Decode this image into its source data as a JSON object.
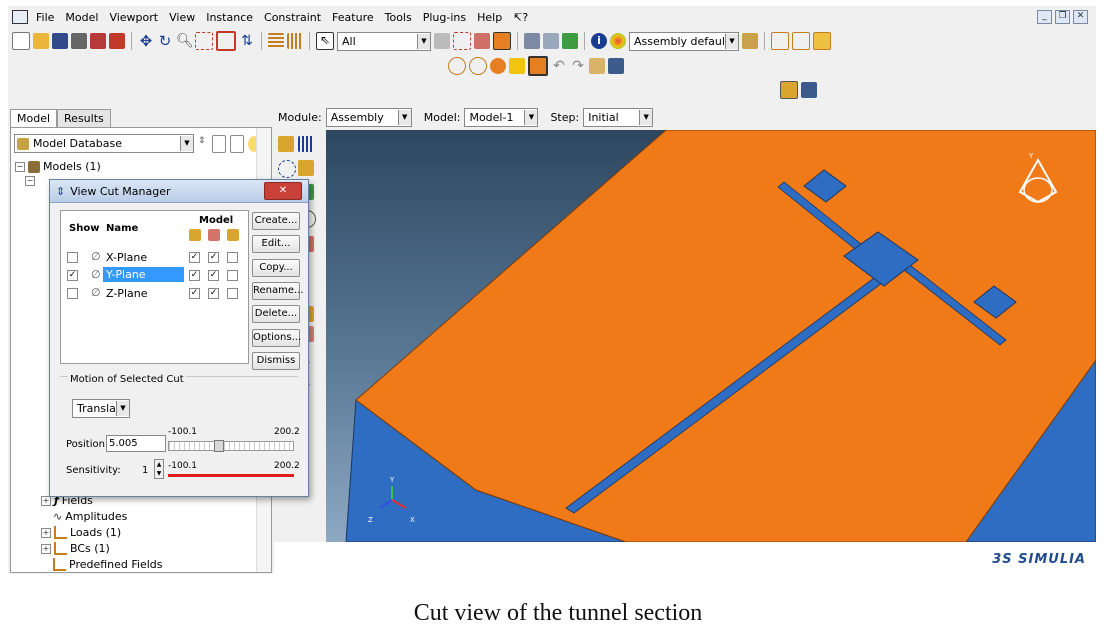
{
  "menu": [
    "File",
    "Model",
    "Viewport",
    "View",
    "Instance",
    "Constraint",
    "Feature",
    "Tools",
    "Plug-ins",
    "Help",
    "↸?"
  ],
  "toolbar": {
    "selection_filter": "All",
    "render_style": "Assembly defaults"
  },
  "left_tabs": [
    "Model",
    "Results"
  ],
  "model_database": "Model Database",
  "tree": {
    "models": "Models (1)",
    "fields": "Fields",
    "amplitudes": "Amplitudes",
    "loads": "Loads (1)",
    "bcs": "BCs (1)",
    "predefined": "Predefined Fields"
  },
  "context": {
    "module_label": "Module:",
    "module": "Assembly",
    "model_label": "Model:",
    "model": "Model-1",
    "step_label": "Step:",
    "step": "Initial"
  },
  "dialog": {
    "title": "View Cut Manager",
    "close": "✕",
    "col_show": "Show",
    "col_name": "Name",
    "col_model": "Model",
    "rows": [
      {
        "name": "X-Plane",
        "show": false
      },
      {
        "name": "Y-Plane",
        "show": true
      },
      {
        "name": "Z-Plane",
        "show": false
      }
    ],
    "buttons": [
      "Create...",
      "Edit...",
      "Copy...",
      "Rename...",
      "Delete...",
      "Options...",
      "Dismiss"
    ],
    "motion_label": "Motion of Selected Cut",
    "motion_mode": "Translate",
    "position_label": "Position:",
    "position_value": "5.005",
    "range_min": "-100.1",
    "range_max": "200.2",
    "sensitivity_label": "Sensitivity:",
    "sensitivity_value": "1"
  },
  "triad": {
    "y": "Y",
    "x": "X",
    "z": "Z"
  },
  "brand": "3S SIMULIA",
  "caption": "Cut view of the tunnel section"
}
